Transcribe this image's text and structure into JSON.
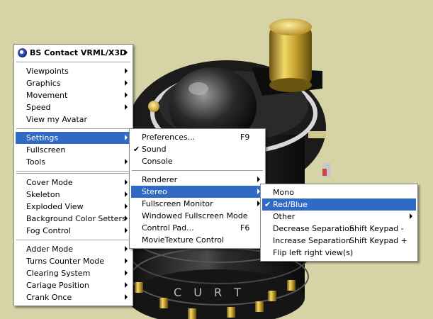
{
  "main_menu": {
    "title": "BS Contact VRML/X3D",
    "group1": [
      {
        "label": "Viewpoints",
        "submenu": true
      },
      {
        "label": "Graphics",
        "submenu": true
      },
      {
        "label": "Movement",
        "submenu": true
      },
      {
        "label": "Speed",
        "submenu": true
      },
      {
        "label": "View my Avatar",
        "submenu": false
      }
    ],
    "group2": [
      {
        "label": "Settings",
        "submenu": true,
        "highlighted": true
      },
      {
        "label": "Fullscreen",
        "submenu": false
      },
      {
        "label": "Tools",
        "submenu": true
      }
    ],
    "group3": [
      {
        "label": "Cover Mode",
        "submenu": true
      },
      {
        "label": "Skeleton",
        "submenu": true
      },
      {
        "label": "Exploded View",
        "submenu": true
      },
      {
        "label": "Background Color Setters",
        "submenu": true
      },
      {
        "label": "Fog Control",
        "submenu": true
      }
    ],
    "group4": [
      {
        "label": "Adder Mode",
        "submenu": true
      },
      {
        "label": "Turns Counter Mode",
        "submenu": true
      },
      {
        "label": "Clearing System",
        "submenu": true
      },
      {
        "label": "Cariage Position",
        "submenu": true
      },
      {
        "label": "Crank Once",
        "submenu": true
      }
    ]
  },
  "settings_menu": {
    "preferences": {
      "label": "Preferences...",
      "shortcut": "F9"
    },
    "sound": {
      "label": "Sound",
      "checked": true
    },
    "console": {
      "label": "Console"
    },
    "renderer": {
      "label": "Renderer",
      "submenu": true
    },
    "stereo": {
      "label": "Stereo",
      "submenu": true,
      "highlighted": true
    },
    "fullscreen_monitor": {
      "label": "Fullscreen Monitor",
      "submenu": true
    },
    "windowed_fullscreen": {
      "label": "Windowed Fullscreen Mode"
    },
    "control_pad": {
      "label": "Control Pad...",
      "shortcut": "F6"
    },
    "movietexture": {
      "label": "MovieTexture Control"
    }
  },
  "stereo_menu": {
    "mono": {
      "label": "Mono"
    },
    "redblue": {
      "label": "Red/Blue",
      "checked": true,
      "highlighted": true
    },
    "other": {
      "label": "Other",
      "submenu": true
    },
    "decrease": {
      "label": "Decrease Separation",
      "shortcut": "Shift Keypad -"
    },
    "increase": {
      "label": "Increase Separation",
      "shortcut": "Shift Keypad +"
    },
    "flip": {
      "label": "Flip left right view(s)"
    }
  },
  "scene": {
    "engraving": "C U R T",
    "colors": {
      "background": "#d6d4a6",
      "menu_highlight": "#316ac5",
      "brass": "#c9a531"
    }
  }
}
